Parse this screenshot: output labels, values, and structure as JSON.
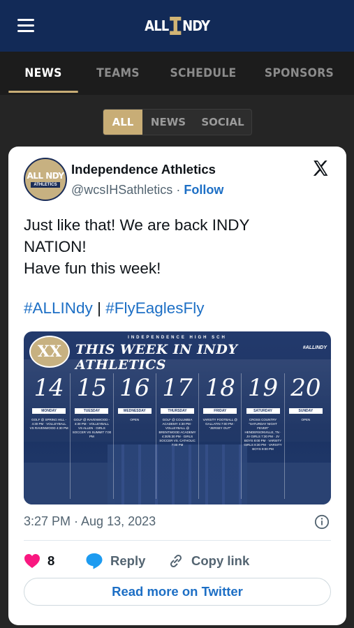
{
  "header": {
    "logo_left": "ALL",
    "logo_right": "NDY",
    "colors": {
      "navy": "#122a57",
      "gold": "#c8ad76"
    }
  },
  "nav": {
    "tabs": [
      {
        "label": "NEWS",
        "active": true
      },
      {
        "label": "TEAMS",
        "active": false
      },
      {
        "label": "SCHEDULE",
        "active": false
      },
      {
        "label": "SPONSORS",
        "active": false
      }
    ]
  },
  "filter": {
    "options": [
      {
        "label": "ALL",
        "active": true
      },
      {
        "label": "NEWS",
        "active": false
      },
      {
        "label": "SOCIAL",
        "active": false
      }
    ]
  },
  "tweet": {
    "account_name": "Independence Athletics",
    "handle": "@wcsIHSathletics",
    "separator": "·",
    "follow_label": "Follow",
    "avatar_text_top": "ALL NDY",
    "avatar_text_bottom": "ATHLETICS",
    "text_lines": [
      "Just like that! We are back INDY",
      "NATION!",
      "Have fun this week!"
    ],
    "hashtag_1": "#ALLINdy",
    "hashtag_sep": "|",
    "hashtag_2": "#FlyEaglesFly",
    "media": {
      "school_label": "INDEPENDENCE HIGH SCH",
      "badge": "XX",
      "title": "THIS WEEK IN INDY ATHLETICS",
      "tag": "#ALLINDY",
      "days": [
        {
          "num": "14",
          "name": "MONDAY",
          "events": "GOLF @ SPRING HILL - 4:30 PM · VOLLEYBALL VS RAVENWOOD 4:30 PM"
        },
        {
          "num": "15",
          "name": "TUESDAY",
          "events": "GOLF @ RAVENWOOD - 4:30 PM · VOLLEYBALL VS ALLEN · GIRLS SOCCER VS SUMMIT 7:00 PM"
        },
        {
          "num": "16",
          "name": "WEDNESDAY",
          "events": "OPEN"
        },
        {
          "num": "17",
          "name": "THURSDAY",
          "events": "GOLF @ COLUMBIA ACADEMY 4:30 PM · VOLLEYBALL @ BRENTWOOD ACADEMY 4:30/5:30 PM · GIRLS SOCCER VS. CATHOLIC 7:00 PM"
        },
        {
          "num": "18",
          "name": "FRIDAY",
          "events": "VARSITY FOOTBALL @ GALLATIN 7:00 PM · \"JERSEY OUT\""
        },
        {
          "num": "19",
          "name": "SATURDAY",
          "events": "CROSS COUNTRY \"SATURDAY NIGHT FEVER\" HENDERSONVILLE, TN · JV GIRLS 7:30 PM · JV BOYS 8:00 PM · VARSITY GIRLS 8:30 PM · VARSITY BOYS 9:00 PM"
        },
        {
          "num": "20",
          "name": "SUNDAY",
          "events": "OPEN"
        }
      ]
    },
    "timestamp": "3:27 PM · Aug 13, 2023",
    "likes": "8",
    "reply_label": "Reply",
    "copy_link_label": "Copy link",
    "read_more_label": "Read more on Twitter",
    "colors": {
      "link": "#1d6fc5",
      "heart": "#f91880",
      "reply": "#1d9bf0"
    }
  }
}
